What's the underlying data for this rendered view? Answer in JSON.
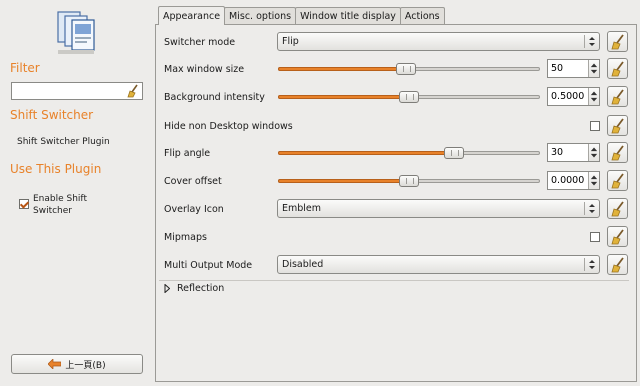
{
  "left": {
    "filter_title": "Filter",
    "filter_value": "",
    "plugin_title": "Shift Switcher",
    "plugin_description": "Shift Switcher Plugin",
    "use_title": "Use This Plugin",
    "enable_label_line1": "Enable Shift",
    "enable_label_line2": "Switcher",
    "enable_checked": true,
    "back_label": "上一頁(B)"
  },
  "tabs": [
    {
      "label": "Appearance",
      "active": true
    },
    {
      "label": "Misc. options",
      "active": false
    },
    {
      "label": "Window title display",
      "active": false
    },
    {
      "label": "Actions",
      "active": false
    }
  ],
  "settings": {
    "switcher_mode": {
      "label": "Switcher mode",
      "value": "Flip"
    },
    "max_window_size": {
      "label": "Max window size",
      "value": "50",
      "level": 0.49
    },
    "background_intensity": {
      "label": "Background intensity",
      "value": "0.5000",
      "level": 0.5
    },
    "hide_non_desktop": {
      "label": "Hide non Desktop windows",
      "checked": false
    },
    "flip_angle": {
      "label": "Flip angle",
      "value": "30",
      "level": 0.67
    },
    "cover_offset": {
      "label": "Cover offset",
      "value": "0.0000",
      "level": 0.5
    },
    "overlay_icon": {
      "label": "Overlay Icon",
      "value": "Emblem"
    },
    "mipmaps": {
      "label": "Mipmaps",
      "checked": false
    },
    "multi_output_mode": {
      "label": "Multi Output Mode",
      "value": "Disabled"
    }
  },
  "reflection": {
    "label": "Reflection"
  },
  "colors": {
    "accent": "#e8822a",
    "background": "#edecea"
  }
}
